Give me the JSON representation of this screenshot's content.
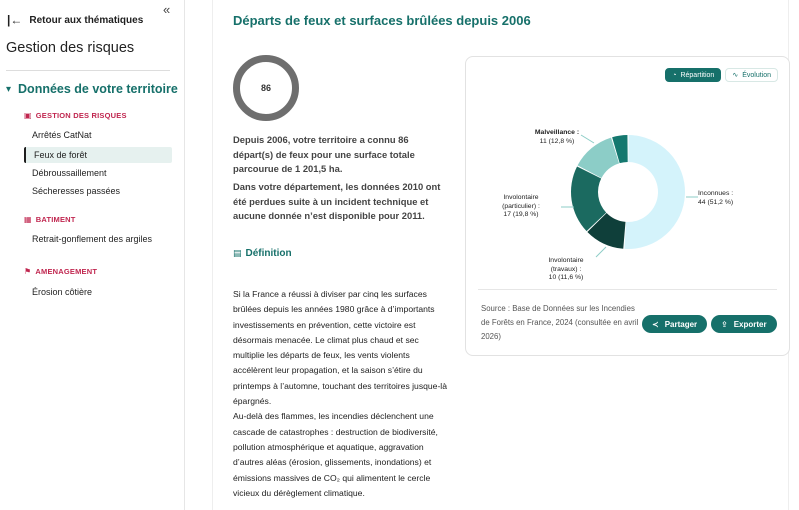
{
  "sidebar": {
    "back_label": "Retour aux thématiques",
    "title": "Gestion des risques",
    "section_label": "Données de votre territoire",
    "categories": [
      {
        "label": "GESTION DES RISQUES",
        "items": [
          "Arrêtés CatNat",
          "Feux de forêt",
          "Débroussaillement",
          "Sécheresses passées"
        ]
      },
      {
        "label": "BATIMENT",
        "items": [
          "Retrait-gonflement des argiles"
        ]
      },
      {
        "label": "AMENAGEMENT",
        "items": [
          "Érosion côtière"
        ]
      }
    ],
    "active_item": "Feux de forêt"
  },
  "main": {
    "title": "Départs de feux et surfaces brûlées depuis 2006",
    "ring_value": "86",
    "summary_1": "Depuis 2006, votre territoire a connu 86 départ(s) de feux pour une surface totale parcourue de 1 201,5 ha.",
    "summary_2": "Dans votre département, les données 2010 ont été perdues suite à un incident technique et aucune donnée n’est disponible pour 2011.",
    "definition_label": "Définition",
    "body_1": "Si la France a réussi à diviser par cinq les surfaces brûlées depuis les années 1980 grâce à d’importants investissements en prévention, cette victoire est désormais menacée. Le climat plus chaud et sec multiplie les départs de feux, les vents violents accélèrent leur propagation, et la saison s’étire du printemps à l’automne, touchant des territoires jusque-là épargnés.",
    "body_2": "Au-delà des flammes, les incendies déclenchent une cascade de catastrophes : destruction de biodiversité, pollution atmosphérique et aquatique, aggravation d’autres aléas (érosion, glissements, inondations) et émissions massives de CO₂ qui alimentent le cercle vicieux du dérèglement climatique."
  },
  "card": {
    "tab_repartition": "Répartition",
    "tab_evolution": "Évolution",
    "source": "Source : Base de Données sur les Incendies de Forêts en France, 2024 (consultée en avril 2026)",
    "share_label": "Partager",
    "export_label": "Exporter"
  },
  "chart_data": {
    "type": "pie",
    "variant": "donut",
    "slices": [
      {
        "label": "Inconnues :",
        "value": 44,
        "pct": "44 (51,2 %)",
        "color": "#d4f3fb"
      },
      {
        "label": "Involontaire (travaux) :",
        "value": 10,
        "pct": "10 (11,6 %)",
        "color": "#0f3f3a"
      },
      {
        "label": "Involontaire (particulier) :",
        "value": 17,
        "pct": "17 (19,8 %)",
        "color": "#1b6a60"
      },
      {
        "label": "Malveillance :",
        "value": 11,
        "pct": "11 (12,8 %)",
        "color": "#8ccdc7"
      },
      {
        "label": "",
        "value": 4,
        "pct": "",
        "color": "#14786f"
      }
    ]
  }
}
